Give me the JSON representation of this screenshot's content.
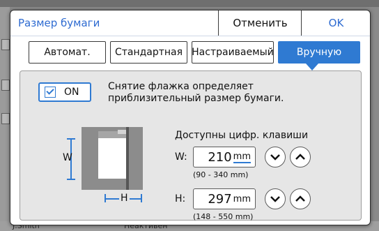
{
  "background": {
    "user": "J.Smith",
    "status": "Неактивен"
  },
  "dialog": {
    "title": "Размер бумаги",
    "cancel_label": "Отменить",
    "ok_label": "OK"
  },
  "tabs": [
    {
      "label": "Автомат.",
      "active": false
    },
    {
      "label": "Стандартная",
      "active": false
    },
    {
      "label": "Настраиваемый",
      "active": false
    },
    {
      "label": "Вручную",
      "active": true
    }
  ],
  "toggle": {
    "label": "ON",
    "checked": true,
    "description": "Снятие флажка определяет приблизительный размер бумаги."
  },
  "figure": {
    "width_label": "W",
    "height_label": "H"
  },
  "keys_title": "Доступны цифр. клавиши",
  "width_field": {
    "label": "W:",
    "value": "210",
    "unit": "mm",
    "range": "(90 - 340 mm)"
  },
  "height_field": {
    "label": "H:",
    "value": "297",
    "unit": "mm",
    "range": "(148 - 550 mm)"
  },
  "colors": {
    "accent": "#2f7ad2",
    "title": "#2e6bd1",
    "panel": "#e6e6e6"
  },
  "icons": [
    "checkbox-checked-icon",
    "chevron-down-icon",
    "chevron-up-icon"
  ]
}
